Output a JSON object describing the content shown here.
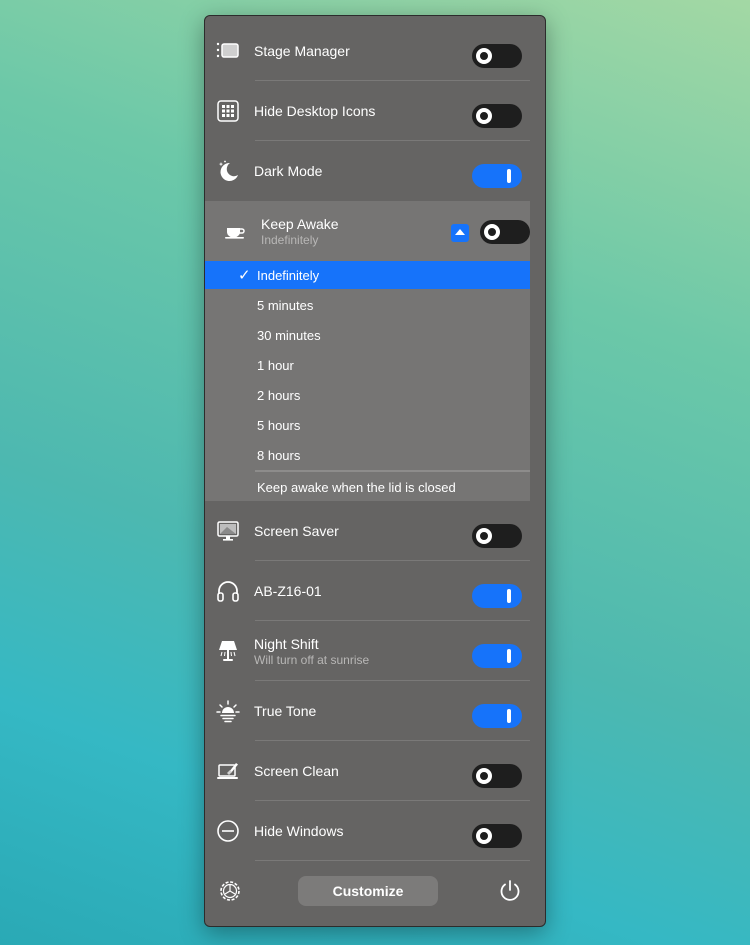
{
  "rows_top": [
    {
      "id": "stage-manager",
      "label": "Stage Manager",
      "sub": "",
      "on": false,
      "icon": "stage-manager-icon"
    },
    {
      "id": "hide-desktop-icons",
      "label": "Hide Desktop Icons",
      "sub": "",
      "on": false,
      "icon": "desktop-grid-icon"
    },
    {
      "id": "dark-mode",
      "label": "Dark Mode",
      "sub": "",
      "on": true,
      "icon": "moon-icon"
    }
  ],
  "keep_awake": {
    "label": "Keep Awake",
    "sub": "Indefinitely",
    "on": false,
    "icon": "coffee-cup-icon",
    "options": [
      "Indefinitely",
      "5 minutes",
      "30 minutes",
      "1 hour",
      "2 hours",
      "5 hours",
      "8 hours"
    ],
    "selected": "Indefinitely",
    "check_mark": "✓",
    "lid_option": "Keep awake when the lid is closed"
  },
  "rows_bottom": [
    {
      "id": "screen-saver",
      "label": "Screen Saver",
      "sub": "",
      "on": false,
      "icon": "monitor-icon"
    },
    {
      "id": "ab-z16-01",
      "label": "AB-Z16-01",
      "sub": "",
      "on": true,
      "icon": "headphones-icon"
    },
    {
      "id": "night-shift",
      "label": "Night Shift",
      "sub": "Will turn off at sunrise",
      "on": true,
      "icon": "lamp-icon"
    },
    {
      "id": "true-tone",
      "label": "True Tone",
      "sub": "",
      "on": true,
      "icon": "sun-icon"
    },
    {
      "id": "screen-clean",
      "label": "Screen Clean",
      "sub": "",
      "on": false,
      "icon": "laptop-clean-icon"
    },
    {
      "id": "hide-windows",
      "label": "Hide Windows",
      "sub": "",
      "on": false,
      "icon": "minus-circle-icon"
    }
  ],
  "footer": {
    "customize_label": "Customize"
  },
  "colors": {
    "accent": "#1673fa",
    "panel": "#656463",
    "toggle_off": "#1e1e1e"
  }
}
